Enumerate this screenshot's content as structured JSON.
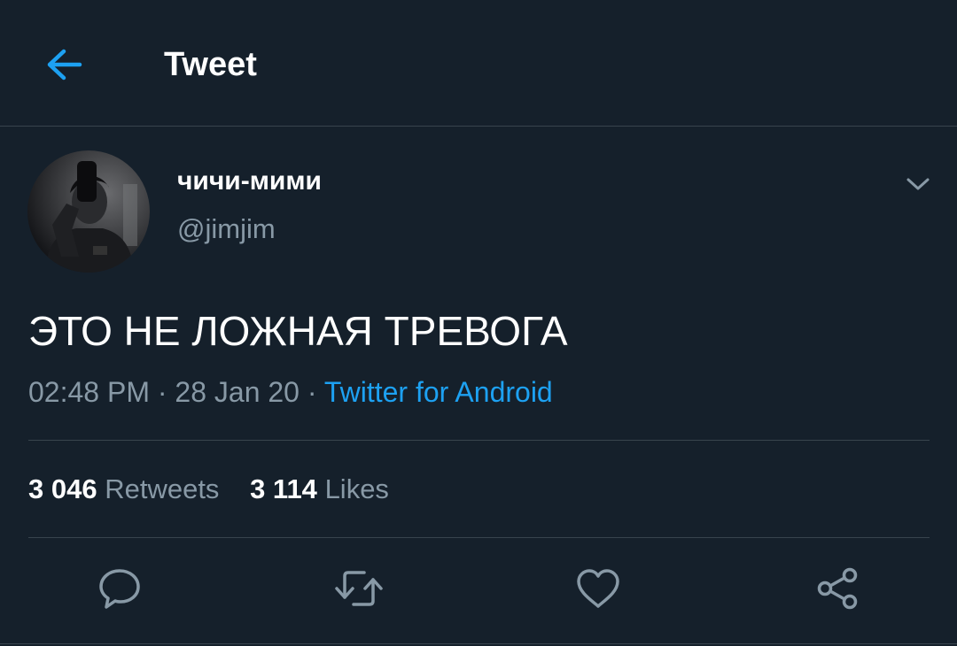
{
  "header": {
    "title": "Tweet",
    "back_icon": "arrow-left-icon"
  },
  "author": {
    "display_name": "чичи-мими",
    "handle": "@jimjim",
    "caret_icon": "chevron-down-icon"
  },
  "tweet": {
    "text": "ЭТО НЕ ЛОЖНАЯ ТРЕВОГА",
    "time": "02:48 PM",
    "separator": "·",
    "date": "28 Jan 20",
    "source": "Twitter for Android"
  },
  "stats": {
    "retweets_count": "3 046",
    "retweets_label": "Retweets",
    "likes_count": "3 114",
    "likes_label": "Likes"
  },
  "actions": [
    {
      "name": "reply",
      "icon": "reply-icon"
    },
    {
      "name": "retweet",
      "icon": "retweet-icon"
    },
    {
      "name": "like",
      "icon": "heart-icon"
    },
    {
      "name": "share",
      "icon": "share-icon"
    }
  ],
  "colors": {
    "background": "#15202b",
    "accent": "#1da1f2",
    "secondary_text": "#8899a6",
    "divider": "#38444d"
  }
}
